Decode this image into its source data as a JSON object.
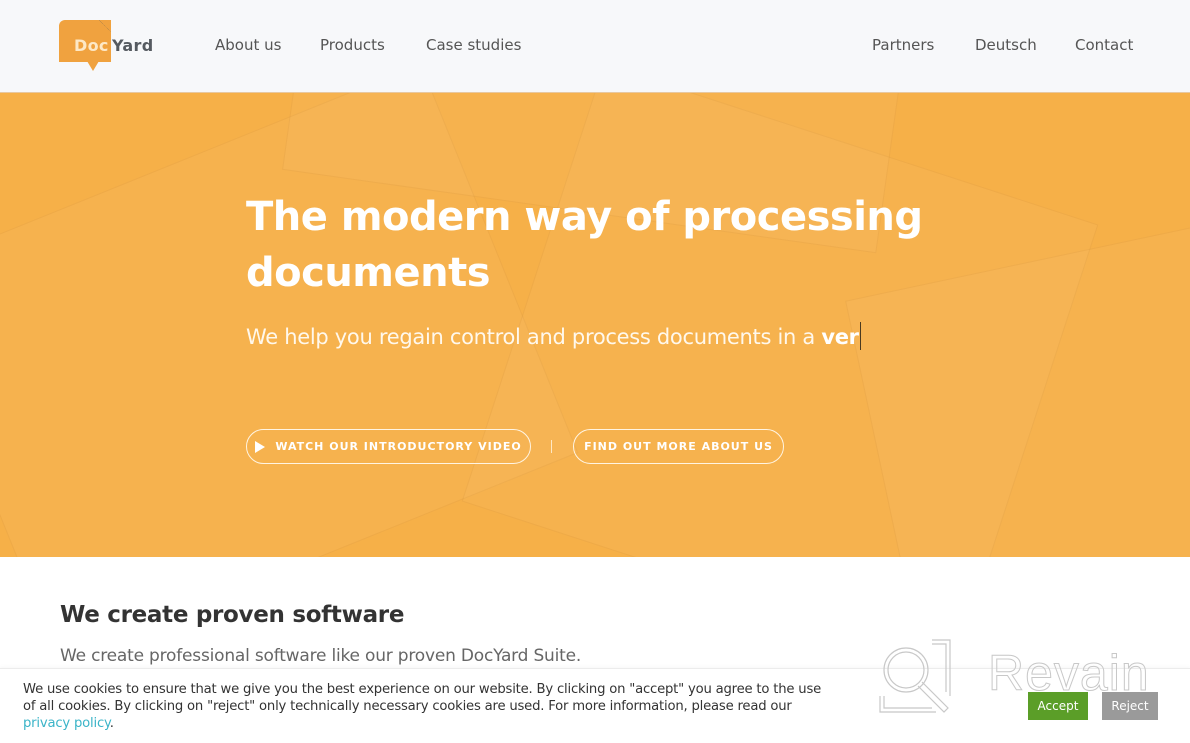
{
  "header": {
    "logo": {
      "part1": "Doc",
      "part2": "Yard"
    },
    "nav_left": [
      {
        "label": "About us"
      },
      {
        "label": "Products"
      },
      {
        "label": "Case studies"
      }
    ],
    "nav_right": [
      {
        "label": "Partners"
      },
      {
        "label": "Deutsch"
      },
      {
        "label": "Contact"
      }
    ]
  },
  "hero": {
    "title": "The modern way of processing documents",
    "subtitle_prefix": "We help you regain control and process documents in a ",
    "subtitle_typed": "ver",
    "buttons": {
      "video": {
        "label": "WATCH OUR INTRODUCTORY VIDEO",
        "icon": "play-icon"
      },
      "about": {
        "label": "FIND OUT MORE ABOUT US"
      }
    },
    "separator": "|"
  },
  "content": {
    "title": "We create proven software",
    "text": "We create professional software like our proven DocYard Suite."
  },
  "cookie": {
    "text": "We use cookies to ensure that we give you the best experience on our website. By clicking on \"accept\" you agree to the use of all cookies. By clicking on \"reject\" only technically necessary cookies are used. For more information, please read our ",
    "link": "privacy policy",
    "suffix": ".",
    "accept_label": "Accept",
    "reject_label": "Reject"
  },
  "watermark": {
    "text": "Revain"
  },
  "colors": {
    "brand_orange": "#f6b048",
    "logo_orange": "#f0a23f",
    "accept_green": "#5b9e28",
    "reject_gray": "#9a9a9a",
    "link_teal": "#3bb4c8"
  }
}
